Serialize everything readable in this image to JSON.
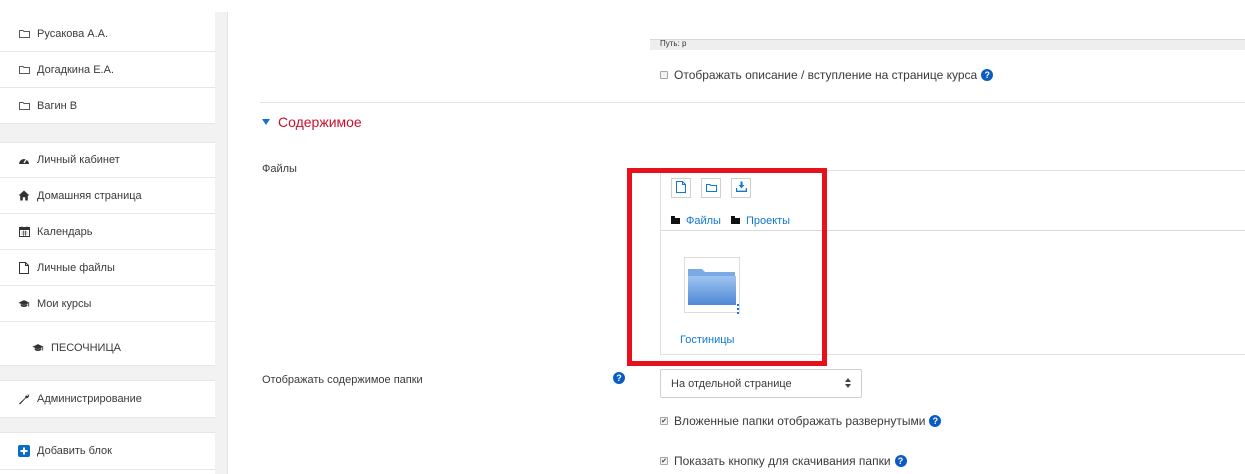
{
  "sidebar": {
    "folders": [
      {
        "label": "Русакова А.А.",
        "icon": "folder-icon"
      },
      {
        "label": "Догадкина Е.А.",
        "icon": "folder-icon"
      },
      {
        "label": "Вагин В",
        "icon": "folder-icon"
      }
    ],
    "nav": [
      {
        "label": "Личный кабинет",
        "icon": "dashboard-icon"
      },
      {
        "label": "Домашняя страница",
        "icon": "home-icon"
      },
      {
        "label": "Календарь",
        "icon": "calendar-icon"
      },
      {
        "label": "Личные файлы",
        "icon": "file-icon"
      },
      {
        "label": "Мои курсы",
        "icon": "graduation-cap-icon"
      },
      {
        "label": "ПЕСОЧНИЦА",
        "icon": "graduation-cap-icon"
      }
    ],
    "admin": {
      "label": "Администрирование",
      "icon": "wrench-icon"
    },
    "add_block": {
      "label": "Добавить блок",
      "icon": "plus-square-icon"
    }
  },
  "editor": {
    "path_label": "Путь: p"
  },
  "options": {
    "show_description": {
      "label": "Отображать описание / вступление на странице курса",
      "checked": false
    }
  },
  "section": {
    "title": "Содержимое"
  },
  "files": {
    "label": "Файлы",
    "toolbar": [
      "add-file-icon",
      "create-folder-icon",
      "download-icon"
    ],
    "breadcrumb": [
      "Файлы",
      "Проекты"
    ],
    "items": [
      {
        "name": "Гостиницы",
        "type": "folder"
      }
    ]
  },
  "display": {
    "label": "Отображать содержимое папки",
    "selected": "На отдельной странице"
  },
  "checkboxes": {
    "expand_subfolders": {
      "label": "Вложенные папки отображать развернутыми",
      "checked": true
    },
    "show_download": {
      "label": "Показать кнопку для скачивания папки",
      "checked": true
    }
  },
  "colors": {
    "accent": "#1177d1",
    "section_title": "#c8102e",
    "highlight_box": "#e8111b",
    "help": "#0a5cc2"
  }
}
